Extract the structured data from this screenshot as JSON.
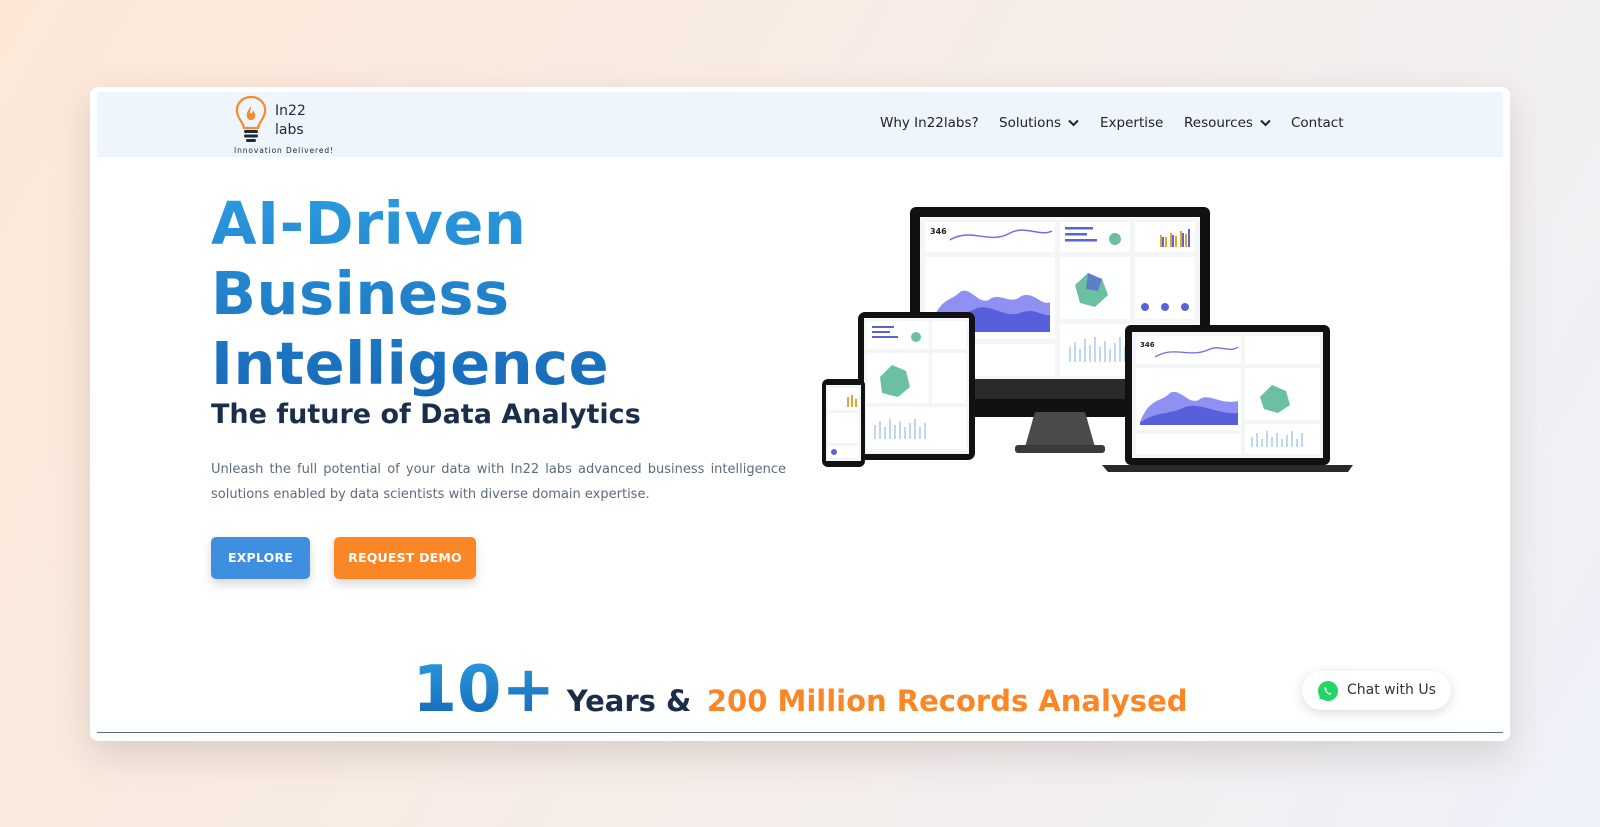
{
  "brand": {
    "name_line1": "In22",
    "name_line2": "labs",
    "tagline": "Innovation Delivered!",
    "logo_icon": "lightbulb-flame-icon"
  },
  "nav": {
    "items": [
      {
        "label": "Why In22labs?",
        "dropdown": false
      },
      {
        "label": "Solutions",
        "dropdown": true
      },
      {
        "label": "Expertise",
        "dropdown": false
      },
      {
        "label": "Resources",
        "dropdown": true
      },
      {
        "label": "Contact",
        "dropdown": false
      }
    ]
  },
  "hero": {
    "title_lines": [
      "AI-Driven",
      "Business",
      "Intelligence"
    ],
    "subtitle": "The future of Data Analytics",
    "description": "Unleash the full potential of your data with In22 labs advanced business intelligence solutions enabled by data scientists with diverse domain expertise.",
    "explore_label": "EXPLORE",
    "demo_label": "REQUEST DEMO",
    "image_alt": "dashboard-devices-mockup"
  },
  "stats": {
    "number": "10+",
    "years_label": "Years &",
    "records_label": "200 Million Records Analysed"
  },
  "chat": {
    "label": "Chat with Us",
    "icon": "whatsapp-icon"
  },
  "colors": {
    "primary_blue": "#1b6fc0",
    "accent_orange": "#fb8626",
    "dark_navy": "#1a2e4a",
    "nav_bg": "#eef5fd",
    "chat_green": "#25d366"
  }
}
